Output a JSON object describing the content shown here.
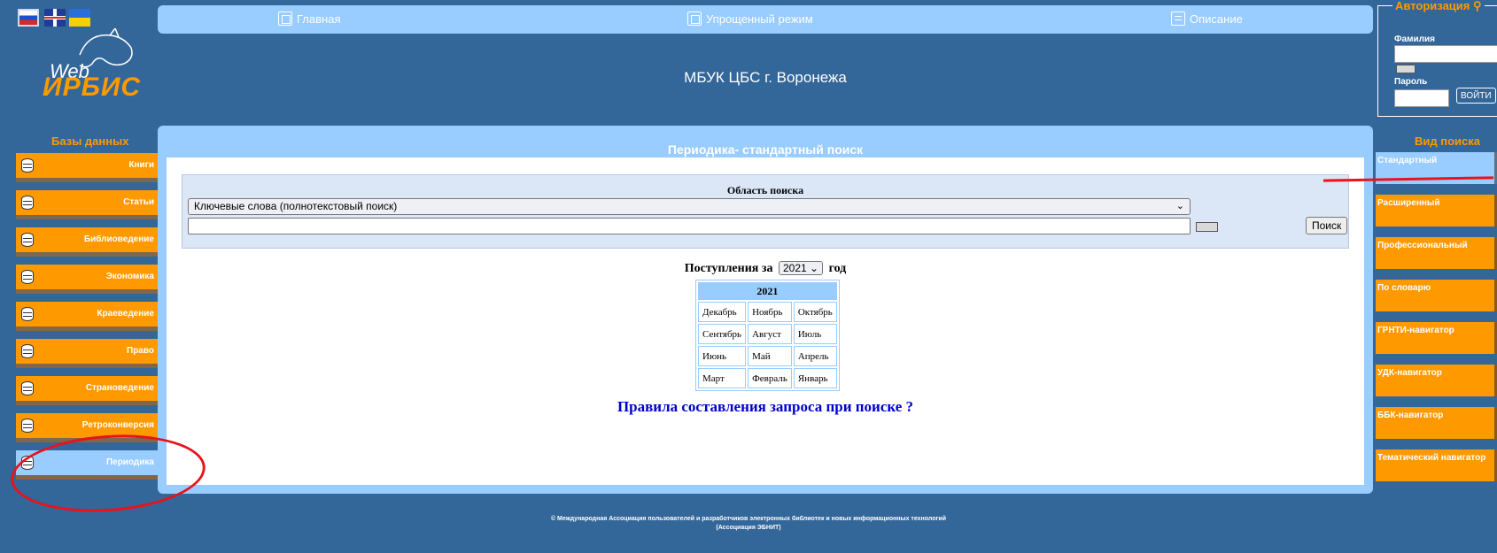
{
  "logo": {
    "web": "Web",
    "irbis": "ИРБИС"
  },
  "nav": {
    "main": "Главная",
    "simple": "Упрощенный режим",
    "description": "Описание"
  },
  "org_name": "МБУК ЦБС г. Воронежа",
  "auth": {
    "title": "Авторизация",
    "surname_label": "Фамилия",
    "password_label": "Пароль",
    "login_button": "ВОЙТИ"
  },
  "sidebar_left": {
    "title": "Базы данных",
    "items": [
      {
        "label": "Книги"
      },
      {
        "label": "Статьи"
      },
      {
        "label": "Библиоведение"
      },
      {
        "label": "Экономика"
      },
      {
        "label": "Краеведение"
      },
      {
        "label": "Право"
      },
      {
        "label": "Страноведение"
      },
      {
        "label": "Ретроконверсия"
      },
      {
        "label": "Периодика",
        "active": true
      }
    ]
  },
  "main": {
    "title": "Периодика- стандартный поиск",
    "search_area_label": "Область поиска",
    "area_selected": "Ключевые слова (полнотекстовый поиск)",
    "query_value": "",
    "search_button": "Поиск",
    "arrivals_prefix": "Поступления за",
    "year_selected": "2021",
    "arrivals_suffix": "год",
    "calendar": {
      "year": "2021",
      "rows": [
        [
          "Декабрь",
          "Ноябрь",
          "Октябрь"
        ],
        [
          "Сентябрь",
          "Август",
          "Июль"
        ],
        [
          "Июнь",
          "Май",
          "Апрель"
        ],
        [
          "Март",
          "Февраль",
          "Январь"
        ]
      ]
    },
    "rules_link": "Правила составления запроса при поиске ?"
  },
  "sidebar_right": {
    "title": "Вид поиска",
    "items": [
      {
        "label": "Стандартный",
        "active": true
      },
      {
        "label": "Расширенный"
      },
      {
        "label": "Профессиональный"
      },
      {
        "label": "По словарю"
      },
      {
        "label": "ГРНТИ-навигатор"
      },
      {
        "label": "УДК-навигатор"
      },
      {
        "label": "ББК-навигатор"
      },
      {
        "label": "Тематический навигатор"
      }
    ]
  },
  "footer": {
    "line1": "© Международная Ассоциация пользователей и разработчиков электронных библиотек и новых информационных технологий",
    "line2": "(Ассоциация ЭБНИТ)"
  },
  "colors": {
    "page_bg": "#336699",
    "panel": "#99ccff",
    "accent_orange": "#ff9900",
    "annotation_red": "#e8131b",
    "link_blue": "#0000cc"
  }
}
